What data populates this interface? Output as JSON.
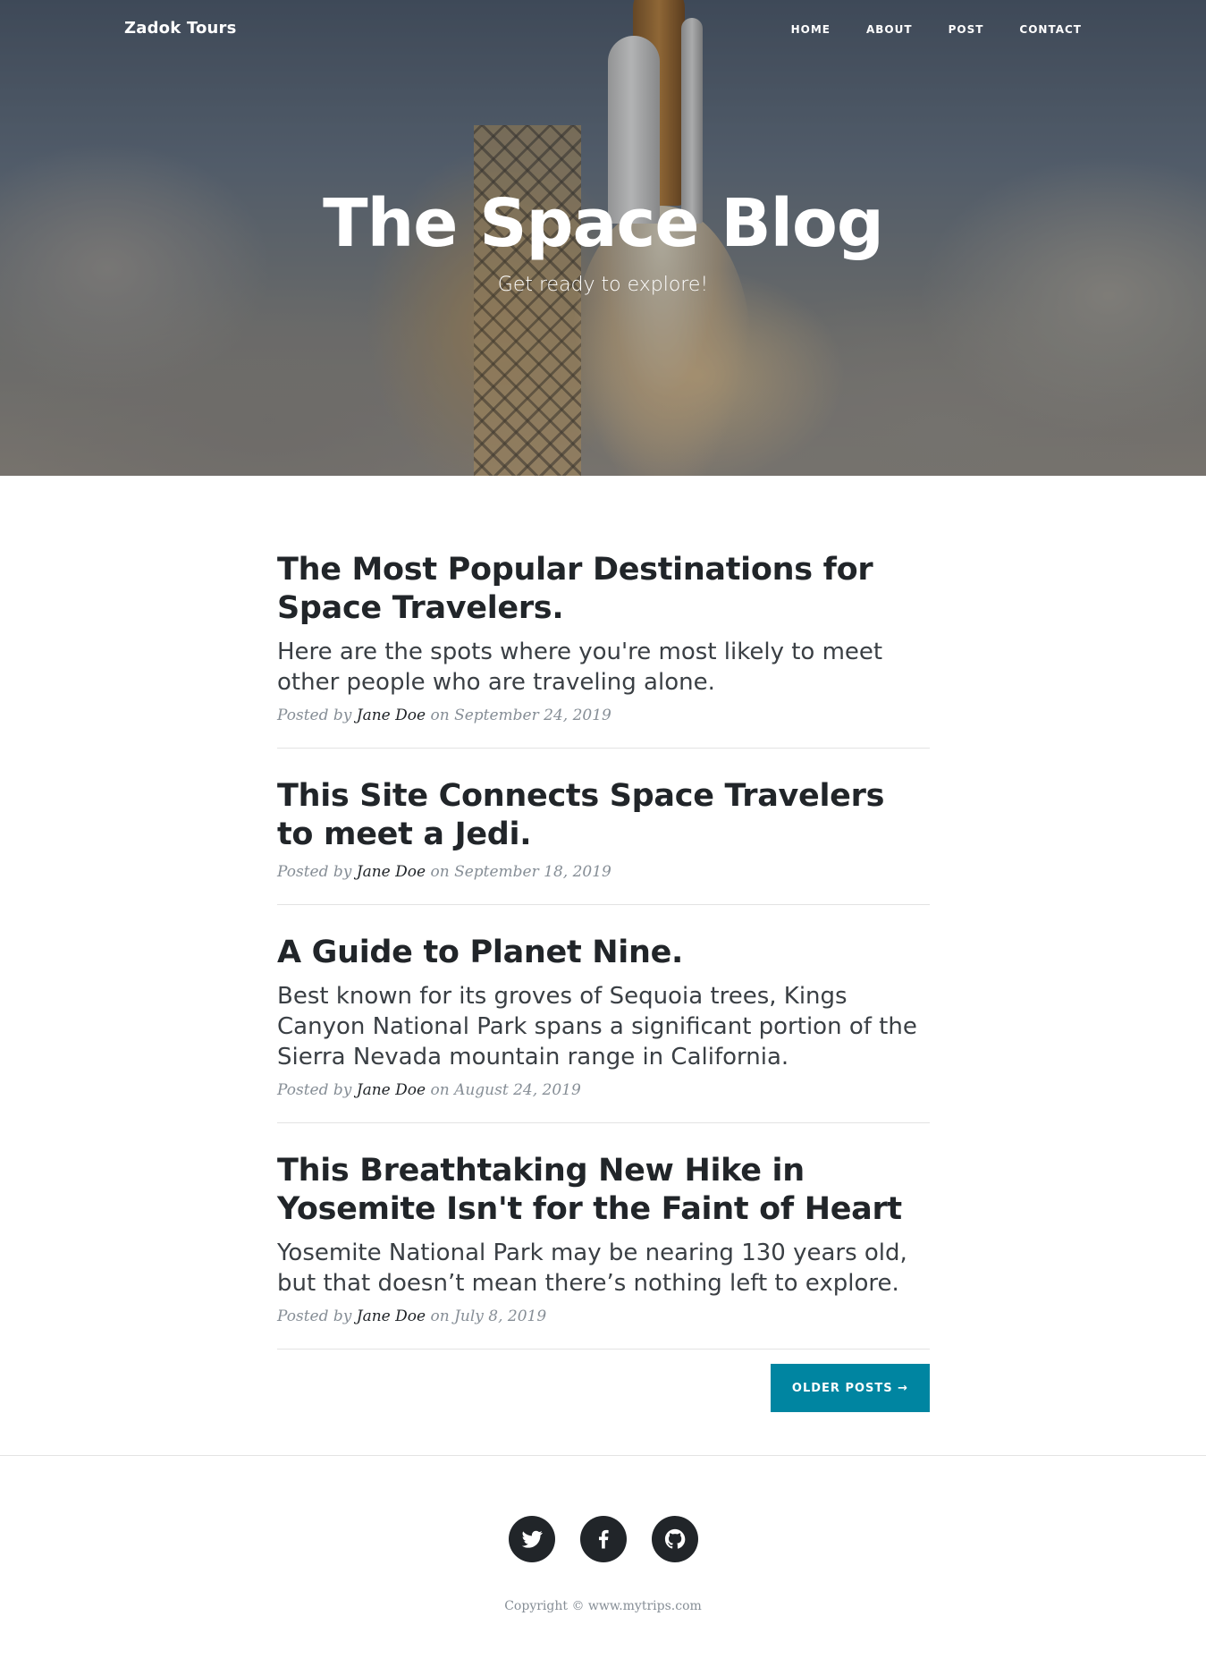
{
  "navbar": {
    "brand": "Zadok Tours",
    "links": [
      "HOME",
      "ABOUT",
      "POST",
      "CONTACT"
    ]
  },
  "hero": {
    "title": "The Space Blog",
    "subtitle": "Get ready to explore!"
  },
  "posts": [
    {
      "title": "The Most Popular Destinations for Space Travelers.",
      "subtitle": "Here are the spots where you're most likely to meet other people who are traveling alone.",
      "meta_prefix": "Posted by",
      "author": "Jane Doe",
      "meta_on": "on",
      "date": "September 24, 2019"
    },
    {
      "title": "This Site Connects Space Travelers to meet a Jedi.",
      "subtitle": "",
      "meta_prefix": "Posted by",
      "author": "Jane Doe",
      "meta_on": "on",
      "date": "September 18, 2019"
    },
    {
      "title": "A Guide to Planet Nine.",
      "subtitle": "Best known for its groves of Sequoia trees, Kings Canyon National Park spans a significant portion of the Sierra Nevada mountain range in California.",
      "meta_prefix": "Posted by",
      "author": "Jane Doe",
      "meta_on": "on",
      "date": "August 24, 2019"
    },
    {
      "title": "This Breathtaking New Hike in Yosemite Isn't for the Faint of Heart",
      "subtitle": "Yosemite National Park may be nearing 130 years old, but that doesn’t mean there’s nothing left to explore.",
      "meta_prefix": "Posted by",
      "author": "Jane Doe",
      "meta_on": "on",
      "date": "July 8, 2019"
    }
  ],
  "pager": {
    "older_label": "OLDER POSTS →"
  },
  "footer": {
    "social_icons": [
      "twitter-icon",
      "facebook-icon",
      "github-icon"
    ],
    "copyright": "Copyright © www.mytrips.com"
  },
  "colors": {
    "accent": "#0085a1",
    "text": "#212529",
    "muted": "#868e96"
  }
}
